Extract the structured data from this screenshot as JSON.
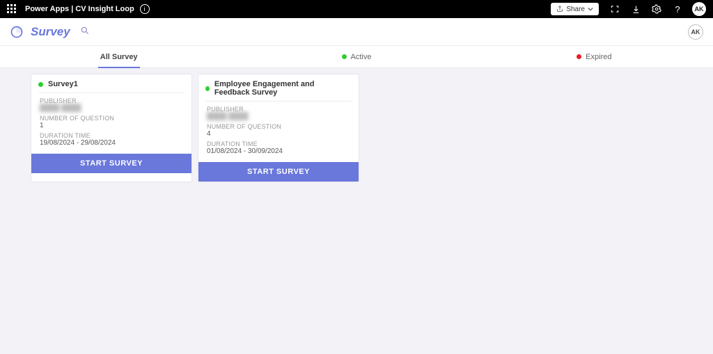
{
  "topbar": {
    "app_label": "Power Apps  |  CV Insight Loop",
    "share_label": "Share",
    "avatar_initials": "AK"
  },
  "subheader": {
    "page_title": "Survey",
    "avatar_initials": "AK"
  },
  "tabs": {
    "all": "All Survey",
    "active": "Active",
    "expired": "Expired"
  },
  "labels": {
    "publisher": "PUBLISHER",
    "question_count": "NUMBER OF QUESTION",
    "duration": "DURATION TIME",
    "start": "START SURVEY"
  },
  "surveys": [
    {
      "title": "Survey1",
      "publisher": "████ ████",
      "questions": "1",
      "duration": "19/08/2024 - 29/08/2024",
      "status": "green"
    },
    {
      "title": "Employee Engagement and Feedback Survey",
      "publisher": "████ ████",
      "questions": "4",
      "duration": "01/08/2024 - 30/09/2024",
      "status": "green"
    }
  ]
}
